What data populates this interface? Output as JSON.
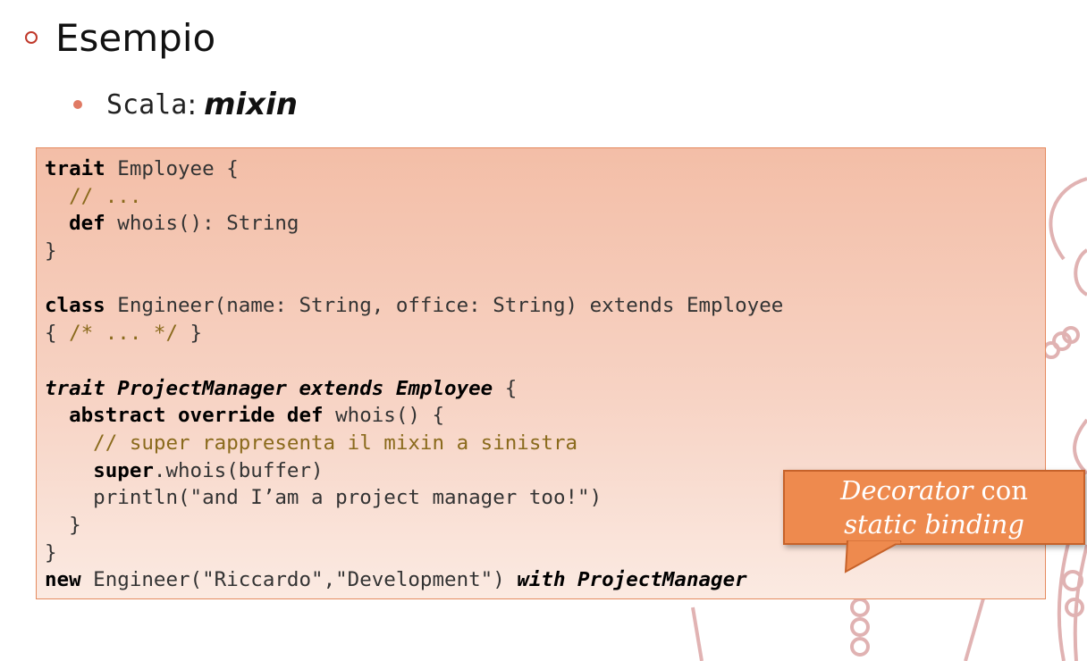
{
  "slide": {
    "heading": "Esempio",
    "bullet": {
      "mono_text": "Scala",
      "separator": ":",
      "emphasis": "mixin"
    }
  },
  "code": {
    "line1": {
      "kw": "trait",
      "rest": " Employee {"
    },
    "line2": {
      "comment": "  // ..."
    },
    "line3": {
      "indent": "  ",
      "kw": "def",
      "rest": " whois(): String"
    },
    "line4": {
      "text": "}"
    },
    "line5": {
      "text": ""
    },
    "line6": {
      "kw": "class",
      "rest": " Engineer(name: String, office: String) extends Employee"
    },
    "line7": {
      "pre": "{ ",
      "comment": "/* ... */",
      "post": " }"
    },
    "line8": {
      "text": ""
    },
    "line9": {
      "kwi": "trait ProjectManager extends Employee",
      "rest": " {"
    },
    "line10": {
      "indent": "  ",
      "kw": "abstract override def",
      "rest": " whois() {"
    },
    "line11": {
      "comment": "    // super rappresenta il mixin a sinistra"
    },
    "line12": {
      "indent": "    ",
      "kw": "super",
      "rest": ".whois(buffer)"
    },
    "line13": {
      "text": "    println(\"and I’am a project manager too!\")"
    },
    "line14": {
      "text": "  }"
    },
    "line15": {
      "text": "}"
    },
    "line16": {
      "kw": "new",
      "mid": " Engineer(\"Riccardo\",\"Development\") ",
      "kwi": "with ProjectManager"
    }
  },
  "callout": {
    "line1_italic": "Decorator",
    "line1_rest": " con",
    "line2_italic": "static binding"
  },
  "colors": {
    "bullet_ring": "#c0392b",
    "bullet_dot": "#e07a64",
    "code_border": "#e58a5e",
    "callout_fill": "#ee8a4e",
    "seal": "#c97a7a"
  },
  "icons": {
    "decoration": "university-seal-icon"
  }
}
